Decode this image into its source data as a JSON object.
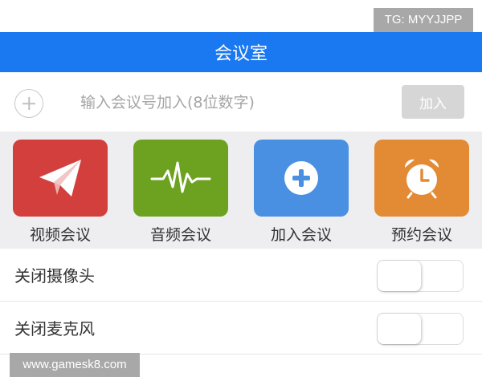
{
  "watermarks": {
    "top": "TG: MYYJJPP",
    "bottom": "www.gamesk8.com"
  },
  "header": {
    "title": "会议室"
  },
  "join": {
    "placeholder": "输入会议号加入(8位数字)",
    "button_label": "加入"
  },
  "actions": [
    {
      "label": "视频会议",
      "icon": "paper-plane-icon",
      "color": "#d23f3c"
    },
    {
      "label": "音频会议",
      "icon": "waveform-icon",
      "color": "#6ca220"
    },
    {
      "label": "加入会议",
      "icon": "plus-circle-icon",
      "color": "#4a90e2"
    },
    {
      "label": "预约会议",
      "icon": "alarm-clock-icon",
      "color": "#e38a35"
    }
  ],
  "settings": [
    {
      "label": "关闭摄像头",
      "enabled": false
    },
    {
      "label": "关闭麦克风",
      "enabled": false
    }
  ]
}
